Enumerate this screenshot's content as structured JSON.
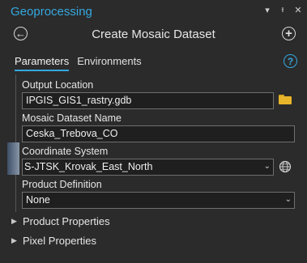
{
  "window": {
    "title": "Geoprocessing",
    "title_color": "#35a8e0"
  },
  "toolbar": {
    "menu_icon": "chevron-down-icon",
    "pin_icon": "pin-icon",
    "close_icon": "close-icon"
  },
  "tool": {
    "title": "Create Mosaic Dataset"
  },
  "tabs": [
    {
      "label": "Parameters",
      "active": true
    },
    {
      "label": "Environments",
      "active": false
    }
  ],
  "help": {
    "glyph": "?"
  },
  "params": {
    "output_location": {
      "label": "Output Location",
      "value": "IPGIS_GIS1_rastry.gdb"
    },
    "dataset_name": {
      "label": "Mosaic Dataset Name",
      "value": "Ceska_Trebova_CO"
    },
    "coordinate_system": {
      "label": "Coordinate System",
      "value": "S-JTSK_Krovak_East_North"
    },
    "product_definition": {
      "label": "Product Definition",
      "value": "None"
    }
  },
  "sections": [
    {
      "label": "Product Properties"
    },
    {
      "label": "Pixel Properties"
    }
  ]
}
